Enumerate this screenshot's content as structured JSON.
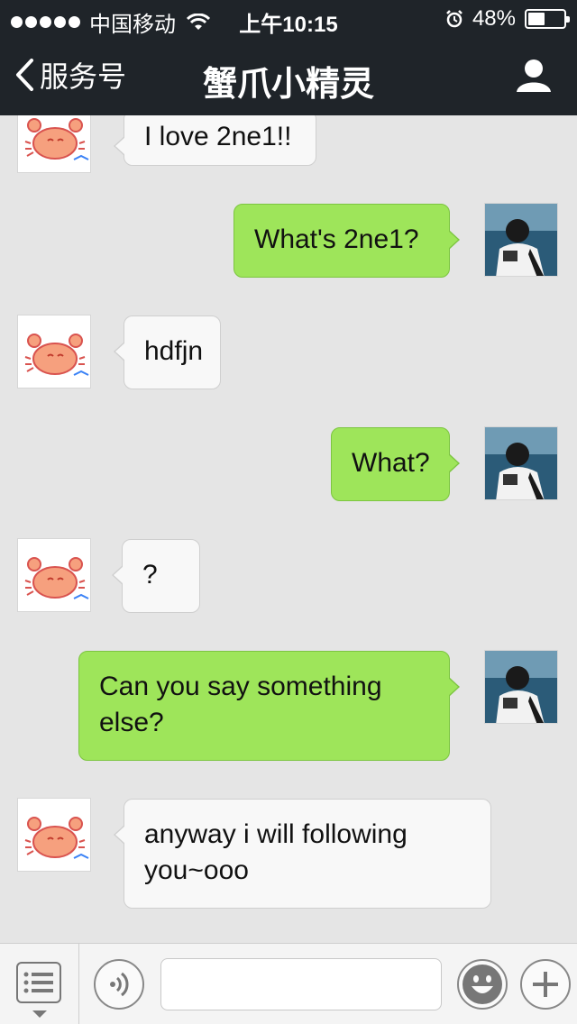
{
  "status_bar": {
    "carrier": "中国移动",
    "time": "上午10:15",
    "battery_text": "48%",
    "battery_level": 0.48
  },
  "nav": {
    "back_label": "服务号",
    "title": "蟹爪小精灵"
  },
  "messages": [
    {
      "direction": "in",
      "text": "I love 2ne1!!"
    },
    {
      "direction": "out",
      "text": "What's 2ne1?"
    },
    {
      "direction": "in",
      "text": "hdfjn"
    },
    {
      "direction": "out",
      "text": "What?"
    },
    {
      "direction": "in",
      "text": "?"
    },
    {
      "direction": "out",
      "text": "Can you say something else?"
    },
    {
      "direction": "in",
      "text": "anyway i will following you~ooo"
    }
  ],
  "input_bar": {
    "input_value": ""
  },
  "colors": {
    "header_bg": "#1f2429",
    "chat_bg": "#e5e5e5",
    "outgoing_bubble": "#9ee55a",
    "incoming_bubble": "#f8f8f8"
  }
}
